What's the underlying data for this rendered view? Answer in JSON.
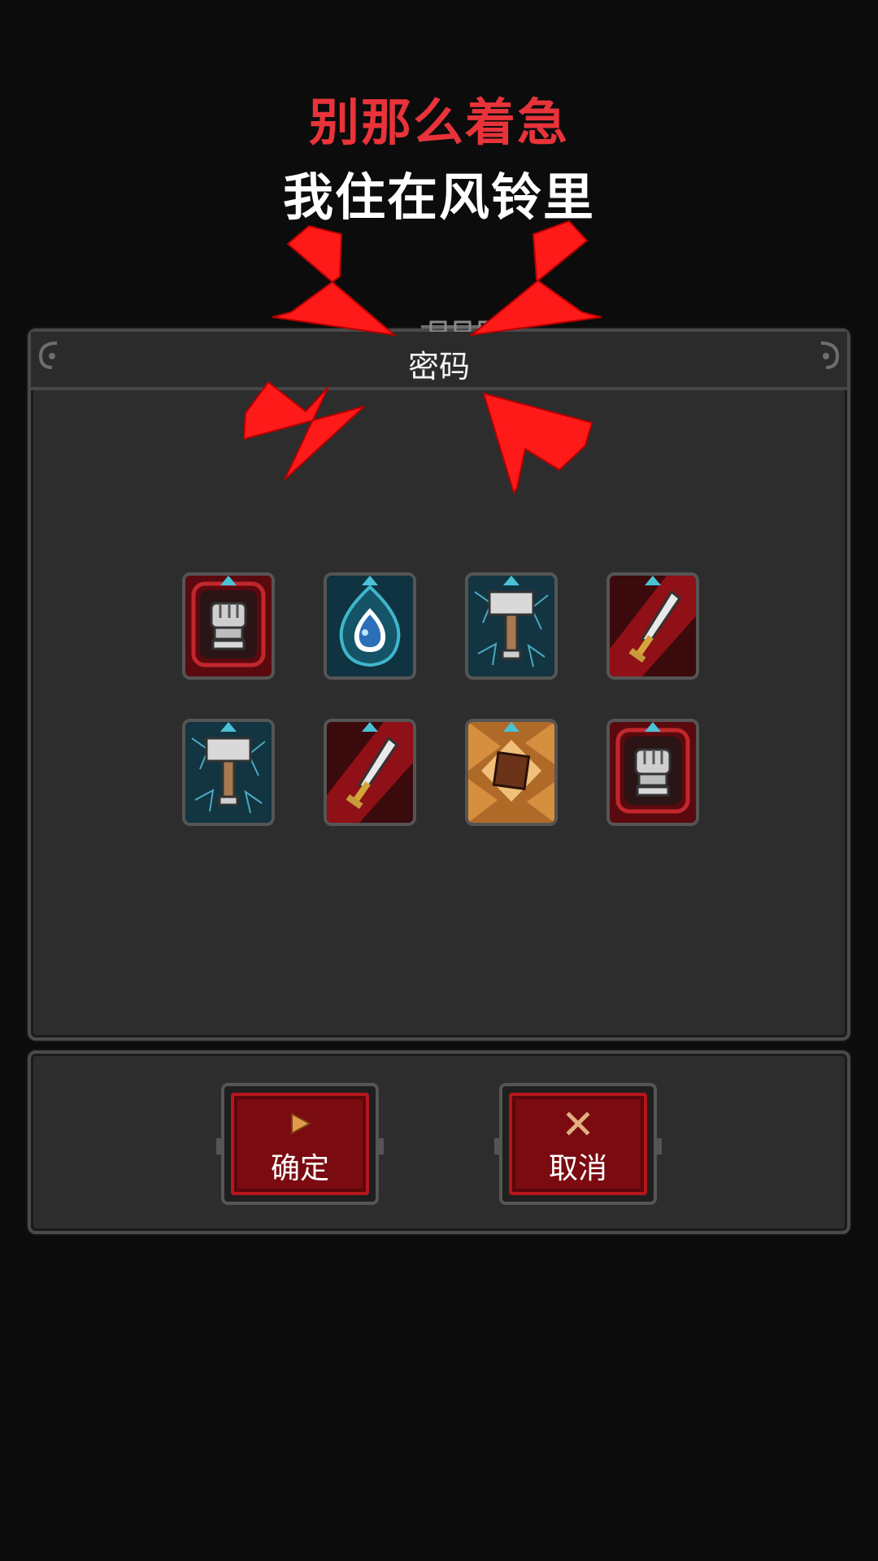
{
  "overlay": {
    "caption_line1": "别那么着急",
    "caption_line2": "我住在风铃里",
    "caption_line1_color": "#e8333a",
    "caption_line2_color": "#ffffff",
    "arrow_color": "#ff1a1a"
  },
  "dialog": {
    "title": "密码",
    "slots": [
      {
        "icon": "fist-icon",
        "theme": "red"
      },
      {
        "icon": "water-drop-icon",
        "theme": "teal"
      },
      {
        "icon": "hammer-icon",
        "theme": "teal"
      },
      {
        "icon": "sword-icon",
        "theme": "red"
      },
      {
        "icon": "hammer-icon",
        "theme": "teal"
      },
      {
        "icon": "sword-icon",
        "theme": "red"
      },
      {
        "icon": "block-icon",
        "theme": "orange"
      },
      {
        "icon": "fist-icon",
        "theme": "red"
      }
    ]
  },
  "buttons": {
    "confirm_label": "确定",
    "confirm_icon": "play-triangle-icon",
    "cancel_label": "取消",
    "cancel_icon": "x-cross-icon"
  },
  "colors": {
    "background": "#0c0c0c",
    "panel": "#2d2d2d",
    "button_red": "#7a0b10"
  }
}
